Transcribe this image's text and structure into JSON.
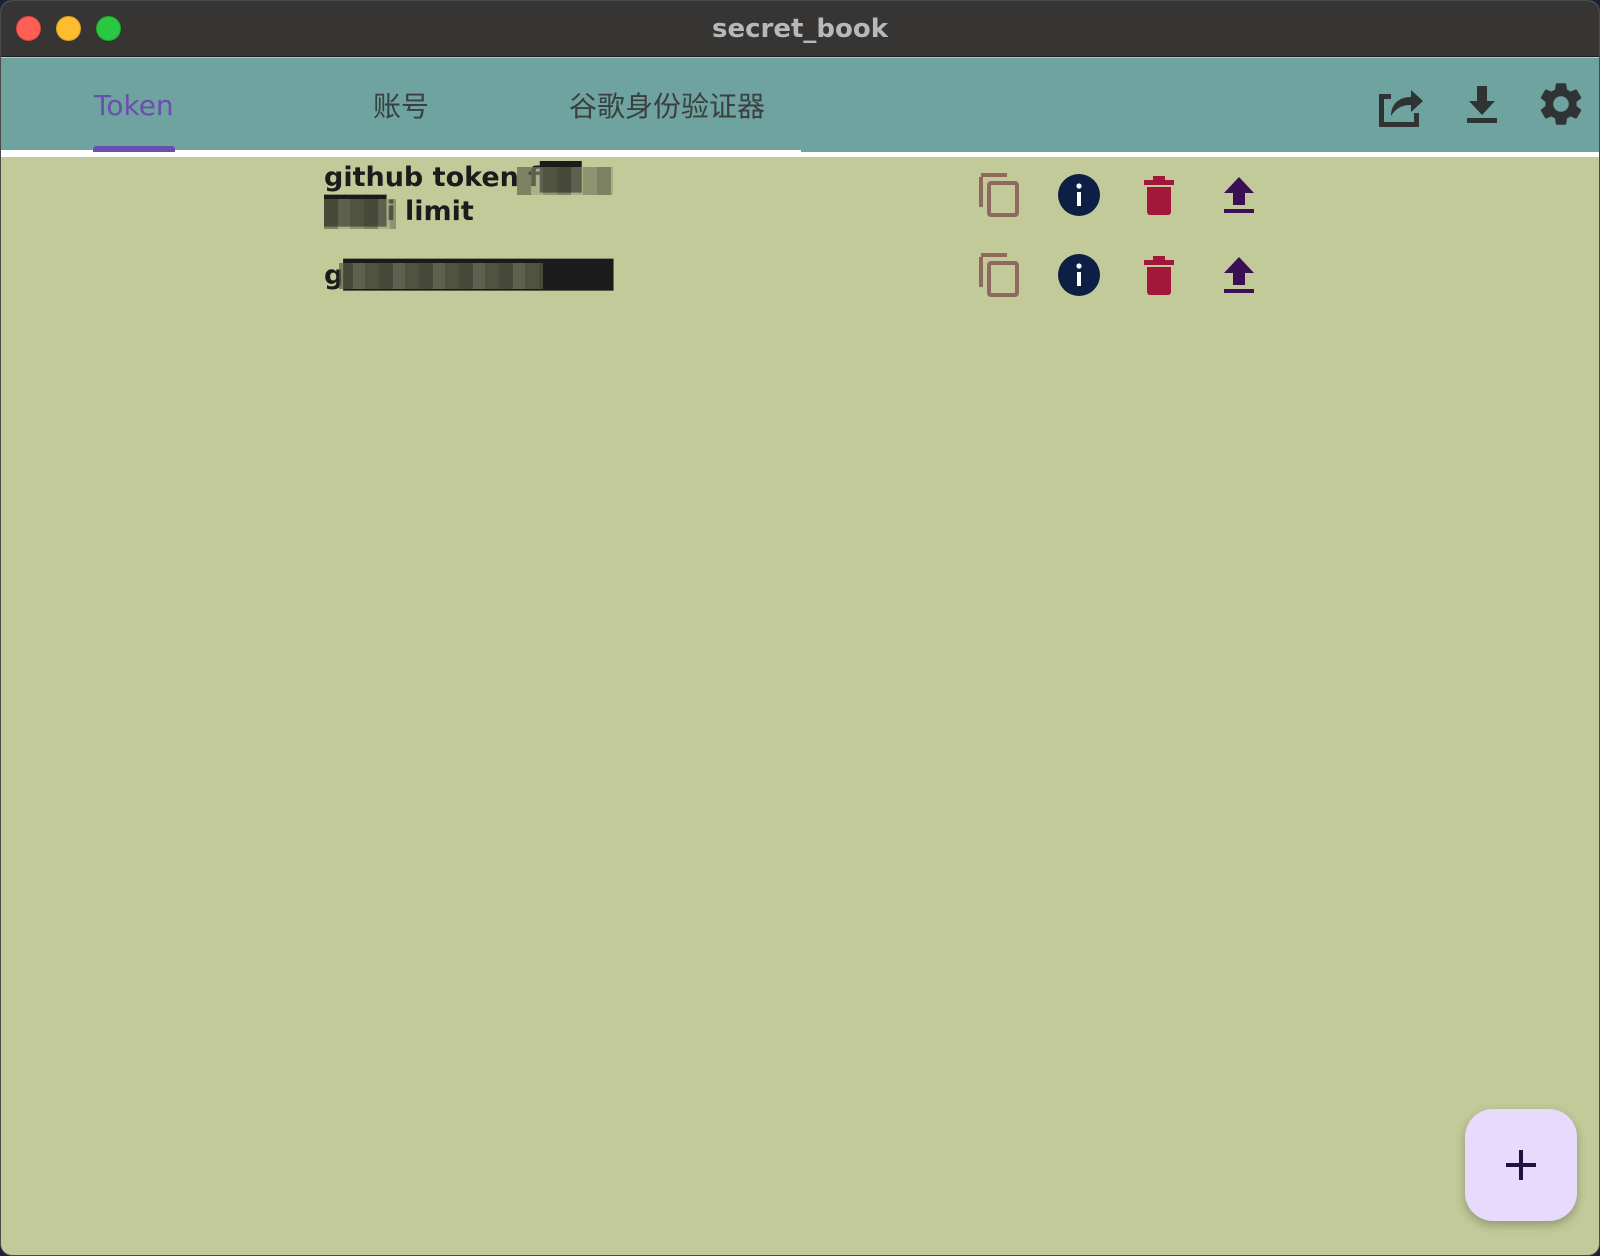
{
  "window": {
    "title": "secret_book"
  },
  "tabs": [
    {
      "label": "Token",
      "active": true
    },
    {
      "label": "账号",
      "active": false
    },
    {
      "label": "谷歌身份验证器",
      "active": false
    }
  ],
  "toolbar_icons": [
    "share-icon",
    "download-icon",
    "settings-icon"
  ],
  "tokens": [
    {
      "name": "github token f██ ███i limit",
      "name_redacted": true
    },
    {
      "name": "g█████████████",
      "name_redacted": true
    }
  ],
  "row_actions": [
    "copy-icon",
    "info-icon",
    "delete-icon",
    "upload-icon"
  ],
  "fab": {
    "icon": "plus-icon"
  },
  "colors": {
    "background": "#c2ca9a",
    "appbar": "#6fa39f",
    "active_tab": "#6a4fb0",
    "copy": "#8d6a5d",
    "info": "#0e1f45",
    "delete": "#a0173a",
    "upload": "#3b0f55",
    "fab": "#e8dafd"
  }
}
